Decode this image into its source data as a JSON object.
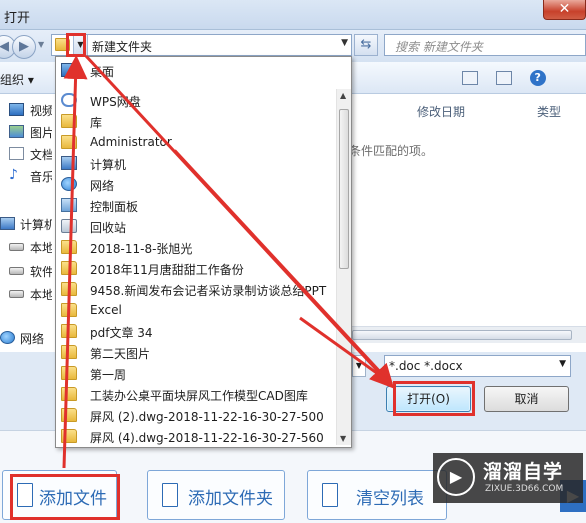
{
  "window": {
    "title": "打开",
    "close_glyph": "✕"
  },
  "address": {
    "current": "新建文件夹"
  },
  "search": {
    "placeholder": "搜索 新建文件夹"
  },
  "toolbar": {
    "organize": "组织 ▾"
  },
  "nav": [
    {
      "label": "视频",
      "icon": "video-icon"
    },
    {
      "label": "图片",
      "icon": "picture-icon"
    },
    {
      "label": "文档",
      "icon": "document-icon"
    },
    {
      "label": "音乐",
      "icon": "music-icon"
    },
    {
      "label": "计算机",
      "icon": "computer-icon"
    },
    {
      "label": "本地",
      "icon": "drive-icon"
    },
    {
      "label": "软件",
      "icon": "drive-icon"
    },
    {
      "label": "本地",
      "icon": "drive-icon"
    },
    {
      "label": "网络",
      "icon": "network-icon"
    }
  ],
  "columns": {
    "modified": "修改日期",
    "type": "类型"
  },
  "empty_message": "条件匹配的项。",
  "filetype": {
    "value": "*.doc *.docx"
  },
  "buttons": {
    "open": "打开(O)",
    "cancel": "取消"
  },
  "dropdown": [
    {
      "label": "桌面",
      "icon": "desktop-icon"
    },
    {
      "label": "WPS网盘",
      "icon": "cloud-icon"
    },
    {
      "label": "库",
      "icon": "folder-icon"
    },
    {
      "label": "Administrator",
      "icon": "folder-icon"
    },
    {
      "label": "计算机",
      "icon": "computer-icon"
    },
    {
      "label": "网络",
      "icon": "network-icon"
    },
    {
      "label": "控制面板",
      "icon": "control-panel-icon"
    },
    {
      "label": "回收站",
      "icon": "recycle-bin-icon"
    },
    {
      "label": "2018-11-8-张旭光",
      "icon": "folder-icon"
    },
    {
      "label": "2018年11月唐甜甜工作备份",
      "icon": "folder-icon"
    },
    {
      "label": "9458.新闻发布会记者采访录制访谈总结PPT",
      "icon": "folder-icon"
    },
    {
      "label": "Excel",
      "icon": "folder-icon"
    },
    {
      "label": "pdf文章  34",
      "icon": "folder-icon"
    },
    {
      "label": "第二天图片",
      "icon": "folder-icon"
    },
    {
      "label": "第一周",
      "icon": "folder-icon"
    },
    {
      "label": "工装办公桌平面块屏风工作模型CAD图库",
      "icon": "folder-icon"
    },
    {
      "label": "屏风 (2).dwg-2018-11-22-16-30-27-500",
      "icon": "folder-icon"
    },
    {
      "label": "屏风 (4).dwg-2018-11-22-16-30-27-560",
      "icon": "folder-icon"
    }
  ],
  "host_buttons": {
    "add_file": "添加文件",
    "add_folder": "添加文件夹",
    "clear_list": "清空列表"
  },
  "watermark": {
    "title": "溜溜自学",
    "url": "ZIXUE.3D66.COM",
    "logo_glyph": "▶"
  },
  "colors": {
    "annotation_red": "#e0312c",
    "accent_blue": "#2d6bb5"
  }
}
